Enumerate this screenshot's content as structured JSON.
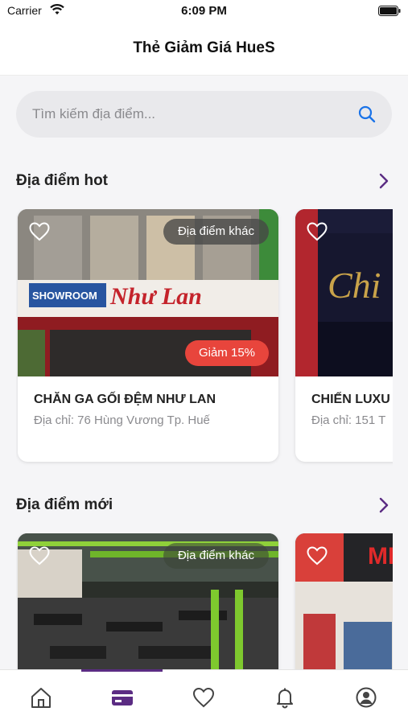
{
  "status_bar": {
    "carrier": "Carrier",
    "time": "6:09 PM"
  },
  "header": {
    "title": "Thẻ Giảm Giá HueS"
  },
  "search": {
    "placeholder": "Tìm kiếm địa điểm..."
  },
  "sections": {
    "hot": {
      "title": "Địa điểm hot",
      "cards": [
        {
          "name": "CHĂN GA GỐI ĐỆM NHƯ LAN",
          "address": "Địa chỉ: 76 Hùng Vương Tp. Huế",
          "tag": "Địa điểm khác",
          "discount": "Giảm 15%",
          "sign_text": "Như Lan",
          "showroom_text": "SHOWROOM"
        },
        {
          "name": "CHIẾN LUXU",
          "address": "Địa chỉ: 151 T",
          "sign_text": "Chi"
        }
      ]
    },
    "new": {
      "title": "Địa điểm mới",
      "cards": [
        {
          "tag": "Địa điểm khác"
        },
        {
          "sign_text": "MI"
        }
      ]
    }
  },
  "tabs": [
    "home",
    "card",
    "favorites",
    "notifications",
    "profile"
  ],
  "active_tab": "card",
  "colors": {
    "accent": "#5b2c83",
    "discount": "#e8453c"
  }
}
